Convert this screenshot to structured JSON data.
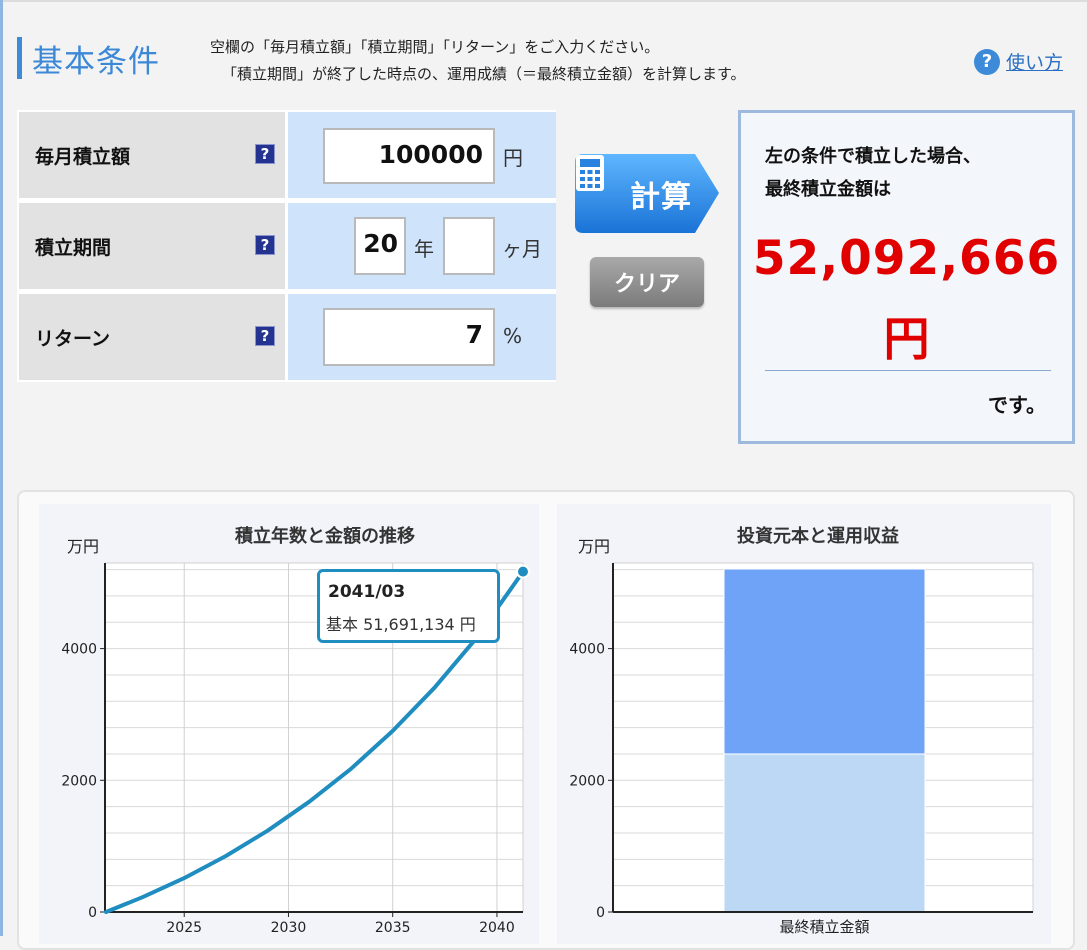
{
  "header": {
    "title": "基本条件",
    "desc_line1": "空欄の「毎月積立額」「積立期間」「リターン」をご入力ください。",
    "desc_line2": "「積立期間」が終了した時点の、運用成績（＝最終積立金額）を計算します。",
    "help_label": "使い方"
  },
  "form": {
    "monthly": {
      "label": "毎月積立額",
      "value": "100000",
      "unit": "円"
    },
    "period": {
      "label": "積立期間",
      "years": "20",
      "years_unit": "年",
      "months": "",
      "months_unit": "ヶ月"
    },
    "return": {
      "label": "リターン",
      "value": "7",
      "unit": "%"
    },
    "help_glyph": "?"
  },
  "buttons": {
    "calc_label": "計算",
    "clear_label": "クリア"
  },
  "result": {
    "line1": "左の条件で積立した場合、",
    "line2": "最終積立金額は",
    "amount": "52,092,666",
    "amount_unit": "円",
    "suffix": "です。"
  },
  "charts": {
    "unit_label": "万円",
    "tooltip_date": "2041/03",
    "tooltip_value": "基本 51,691,134 円"
  },
  "colors": {
    "accent": "#3c8ad8",
    "result_red": "#e00000",
    "line": "#1f8dbf",
    "bar_principal": "#bcd8f5",
    "bar_gain": "#6fa3f7"
  },
  "chart_data": [
    {
      "type": "line",
      "title": "積立年数と金額の推移",
      "ylabel": "万円",
      "xticks": [
        2025,
        2030,
        2035,
        2040
      ],
      "yticks": [
        0,
        2000,
        4000
      ],
      "xlim": [
        2021.2,
        2041.25
      ],
      "ylim": [
        0,
        5300
      ],
      "series": [
        {
          "name": "基本",
          "x": [
            2021.25,
            2023,
            2025,
            2027,
            2029,
            2031,
            2033,
            2035,
            2037,
            2039,
            2041.25
          ],
          "y": [
            0,
            225,
            515,
            850,
            1235,
            1675,
            2175,
            2750,
            3405,
            4155,
            5169
          ]
        }
      ]
    },
    {
      "type": "bar",
      "stacked": true,
      "title": "投資元本と運用収益",
      "ylabel": "万円",
      "categories": [
        "最終積立金額"
      ],
      "yticks": [
        0,
        2000,
        4000
      ],
      "ylim": [
        0,
        5300
      ],
      "series": [
        {
          "name": "投資元本",
          "values": [
            2400
          ]
        },
        {
          "name": "運用収益",
          "values": [
            2809
          ]
        }
      ]
    }
  ]
}
